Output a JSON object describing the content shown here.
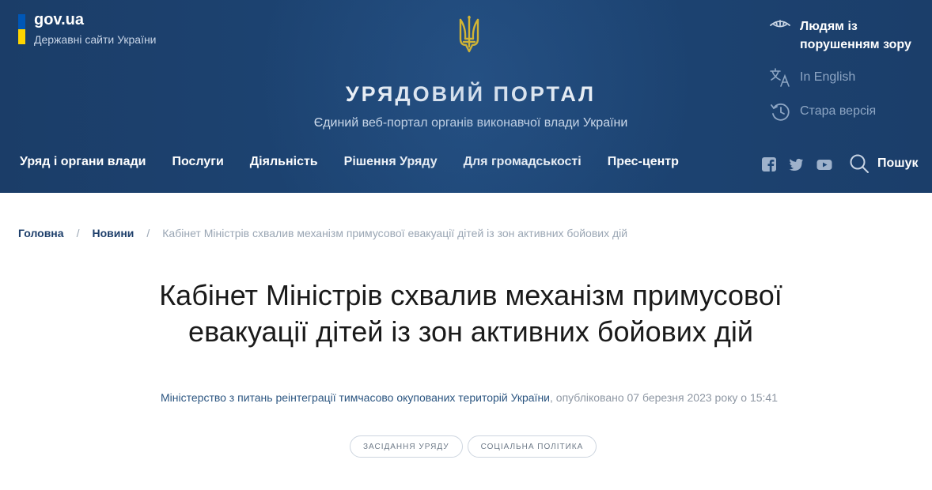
{
  "brand": {
    "domain": "gov.ua",
    "subtitle": "Державні сайти України"
  },
  "header": {
    "emblem_icon": "trident-icon",
    "title": "УРЯДОВИЙ ПОРТАЛ",
    "subtitle": "Єдиний веб-портал органів виконавчої влади України"
  },
  "utilities": {
    "vision_label_1": "Людям із",
    "vision_label_2": "порушенням зору",
    "english_label": "In English",
    "old_version_label": "Стара версія"
  },
  "nav": {
    "items": [
      {
        "label": "Уряд і органи влади"
      },
      {
        "label": "Послуги"
      },
      {
        "label": "Діяльність"
      },
      {
        "label": "Рішення Уряду"
      },
      {
        "label": "Для громадськості"
      },
      {
        "label": "Прес-центр"
      }
    ]
  },
  "social": {
    "icons": [
      "facebook-icon",
      "twitter-icon",
      "youtube-icon"
    ]
  },
  "search": {
    "label": "Пошук"
  },
  "breadcrumb": {
    "home": "Головна",
    "news": "Новини",
    "separator": "/",
    "current": "Кабінет Міністрів схвалив механізм примусової евакуації дітей із зон активних бойових дій"
  },
  "article": {
    "title": "Кабінет Міністрів схвалив механізм примусової евакуації дітей із зон активних бойових дій",
    "source": "Міністерство з питань реінтеграції тимчасово окупованих територій України",
    "published": ", опубліковано 07 березня 2023 року о 15:41",
    "tags": [
      "ЗАСІДАННЯ УРЯДУ",
      "СОЦІАЛЬНА ПОЛІТИКА"
    ]
  },
  "colors": {
    "header_bg": "#1d4676",
    "flag_blue": "#0057b7",
    "flag_yellow": "#ffd500",
    "link": "#1e3f6b",
    "muted": "#9aa6b4"
  }
}
